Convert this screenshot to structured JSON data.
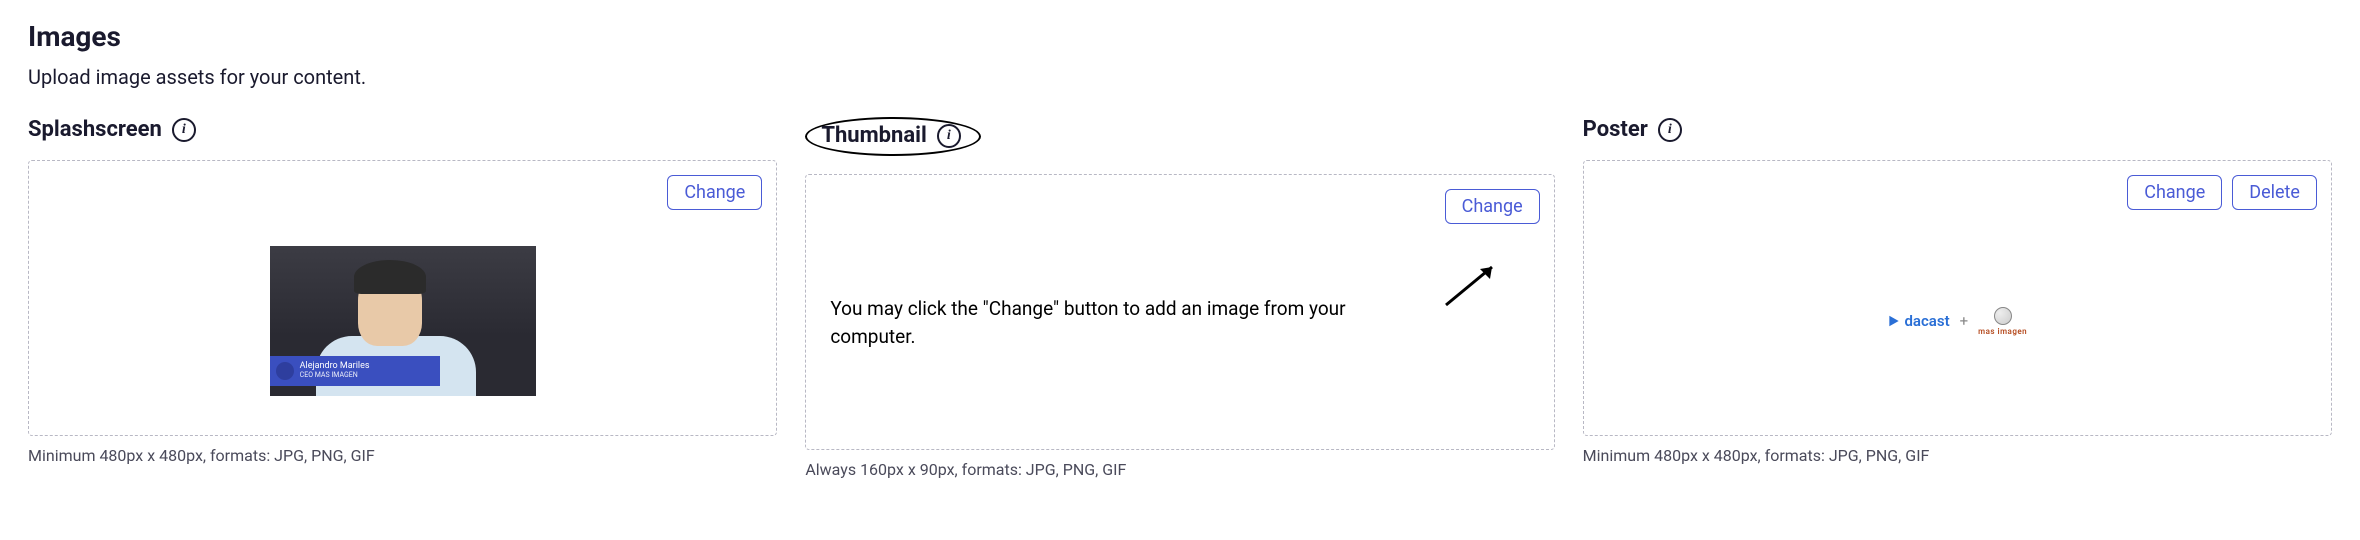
{
  "section": {
    "title": "Images",
    "description": "Upload image assets for your content."
  },
  "cards": {
    "splashscreen": {
      "label": "Splashscreen",
      "change_label": "Change",
      "caption": "Minimum 480px x 480px, formats: JPG, PNG, GIF",
      "preview": {
        "name_line1": "Alejandro Mariles",
        "name_line2": "CEO MAS IMAGEN"
      }
    },
    "thumbnail": {
      "label": "Thumbnail",
      "change_label": "Change",
      "caption": "Always 160px x 90px, formats: JPG, PNG, GIF",
      "helper_text": "You may click the \"Change\" button to add an image from your computer."
    },
    "poster": {
      "label": "Poster",
      "change_label": "Change",
      "delete_label": "Delete",
      "caption": "Minimum 480px x 480px, formats: JPG, PNG, GIF",
      "preview": {
        "logo1": "dacast",
        "plus": "+",
        "logo2": "mas imagen"
      }
    }
  }
}
